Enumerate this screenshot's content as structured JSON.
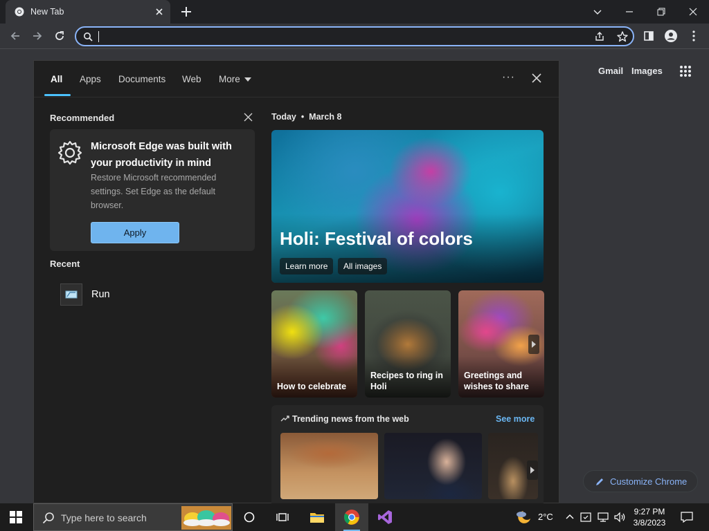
{
  "browser": {
    "tab_title": "New Tab",
    "omnibox_value": "",
    "colors": {
      "accent": "#8ab4f8",
      "frame": "#202124",
      "toolbar": "#35363a"
    }
  },
  "ntp": {
    "gmail_label": "Gmail",
    "images_label": "Images",
    "customize_label": "Customize Chrome"
  },
  "search_panel": {
    "tabs": [
      {
        "label": "All",
        "active": true
      },
      {
        "label": "Apps"
      },
      {
        "label": "Documents"
      },
      {
        "label": "Web"
      },
      {
        "label": "More"
      }
    ],
    "recommended": {
      "heading": "Recommended",
      "card_title": "Microsoft Edge was built with your productivity in mind",
      "card_desc": "Restore Microsoft recommended settings. Set Edge as the default browser.",
      "apply_label": "Apply"
    },
    "recent": {
      "heading": "Recent",
      "items": [
        {
          "label": "Run",
          "icon": "run-dialog-icon"
        }
      ]
    },
    "highlights": {
      "today_label": "Today",
      "date": "March 8",
      "hero_title": "Holi: Festival of colors",
      "hero_buttons": [
        "Learn more",
        "All images"
      ],
      "cards": [
        {
          "label": "How to celebrate"
        },
        {
          "label": "Recipes to ring in Holi"
        },
        {
          "label": "Greetings and wishes to share"
        }
      ],
      "trending_heading": "Trending news from the web",
      "see_more_label": "See more"
    },
    "colors": {
      "tab_underline": "#4cc2ff",
      "apply_button": "#6fb4ee",
      "see_more": "#6ab6f2"
    }
  },
  "taskbar": {
    "search_placeholder": "Type here to search",
    "pinned_apps": [
      "cortana-icon",
      "task-view-icon",
      "file-explorer-icon",
      "chrome-icon",
      "visual-studio-icon"
    ],
    "temperature": "2°C",
    "time": "9:27 PM",
    "date": "3/8/2023"
  }
}
